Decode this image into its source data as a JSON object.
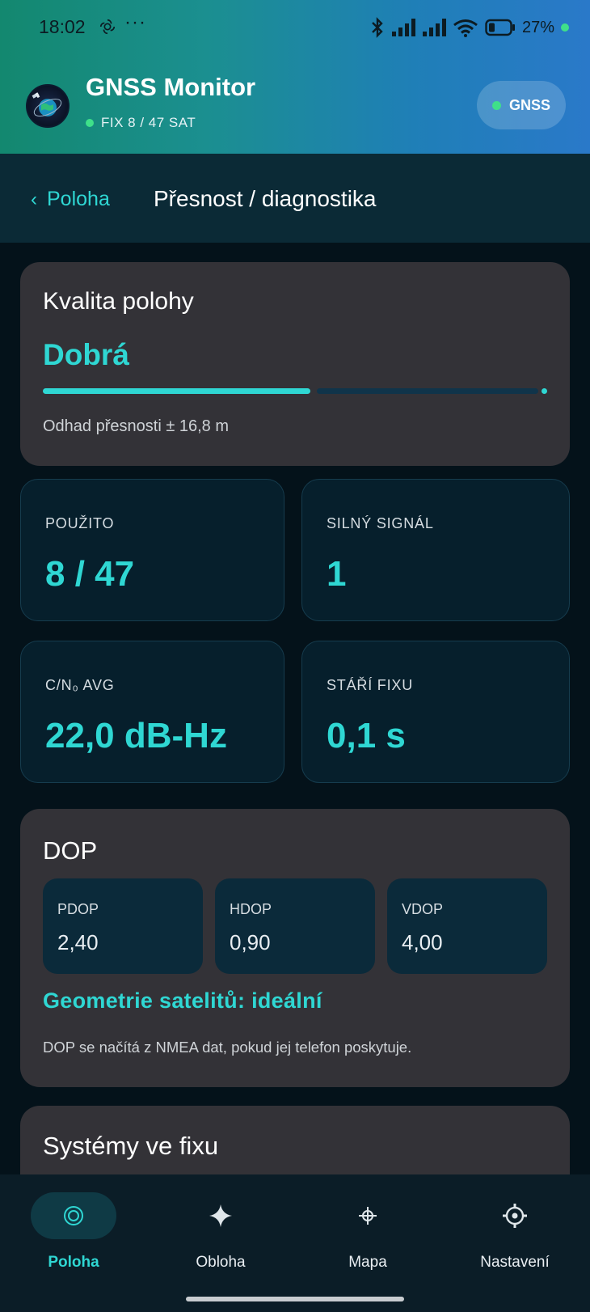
{
  "status_bar": {
    "time": "18:02",
    "more": "···",
    "battery": "27%"
  },
  "app": {
    "title": "GNSS Monitor",
    "subtitle": "FIX 8 / 47 SAT",
    "pill_label": "GNSS",
    "accent": "#2fd7d3",
    "live_color": "#3fe08a"
  },
  "subnav": {
    "back_label": "Poloha",
    "title": "Přesnost / diagnostika"
  },
  "quality": {
    "label": "Kvalita polohy",
    "value": "Dobrá",
    "level": 0.53,
    "note": "Odhad přesnosti ± 16,8 m"
  },
  "stats": [
    {
      "label": "POUŽITO",
      "value": "8 / 47"
    },
    {
      "label": "SILNÝ SIGNÁL",
      "value": "1"
    },
    {
      "label": "C/N₀ AVG",
      "value": "22,0 dB-Hz"
    },
    {
      "label": "STÁŘÍ FIXU",
      "value": "0,1 s"
    }
  ],
  "dop": {
    "title": "DOP",
    "items": [
      {
        "label": "PDOP",
        "value": "2,40"
      },
      {
        "label": "HDOP",
        "value": "0,90"
      },
      {
        "label": "VDOP",
        "value": "4,00"
      }
    ],
    "geometry": "Geometrie satelitů: ideální",
    "note": "DOP se načítá z NMEA dat, pokud jej telefon poskytuje."
  },
  "systems": {
    "title": "Systémy ve fixu"
  },
  "bottom_nav": [
    {
      "label": "Poloha",
      "icon": "target-icon",
      "active": true
    },
    {
      "label": "Obloha",
      "icon": "sparkle-icon",
      "active": false
    },
    {
      "label": "Mapa",
      "icon": "crosshair-icon",
      "active": false
    },
    {
      "label": "Nastavení",
      "icon": "gear-icon",
      "active": false
    }
  ]
}
